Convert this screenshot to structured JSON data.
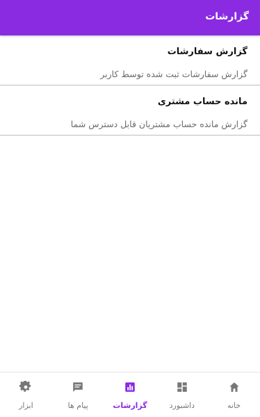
{
  "appbar": {
    "title": "گزارشات",
    "color": "#8a2be2"
  },
  "reports": [
    {
      "title": "گزارش سفارشات",
      "description": "گزارش سفارشات ثبت شده توسط کاربر"
    },
    {
      "title": "مانده حساب مشتری",
      "description": "گزارش مانده حساب مشتریان قابل دسترس شما"
    }
  ],
  "bottom_nav": {
    "active": "reports",
    "items": [
      {
        "id": "home",
        "label": "خانه",
        "icon": "home-icon"
      },
      {
        "id": "dashboard",
        "label": "داشبورد",
        "icon": "dashboard-icon"
      },
      {
        "id": "reports",
        "label": "گزارشات",
        "icon": "bar-chart-icon"
      },
      {
        "id": "messages",
        "label": "پیام ها",
        "icon": "message-icon"
      },
      {
        "id": "tools",
        "label": "ابزار",
        "icon": "gear-icon"
      }
    ]
  }
}
